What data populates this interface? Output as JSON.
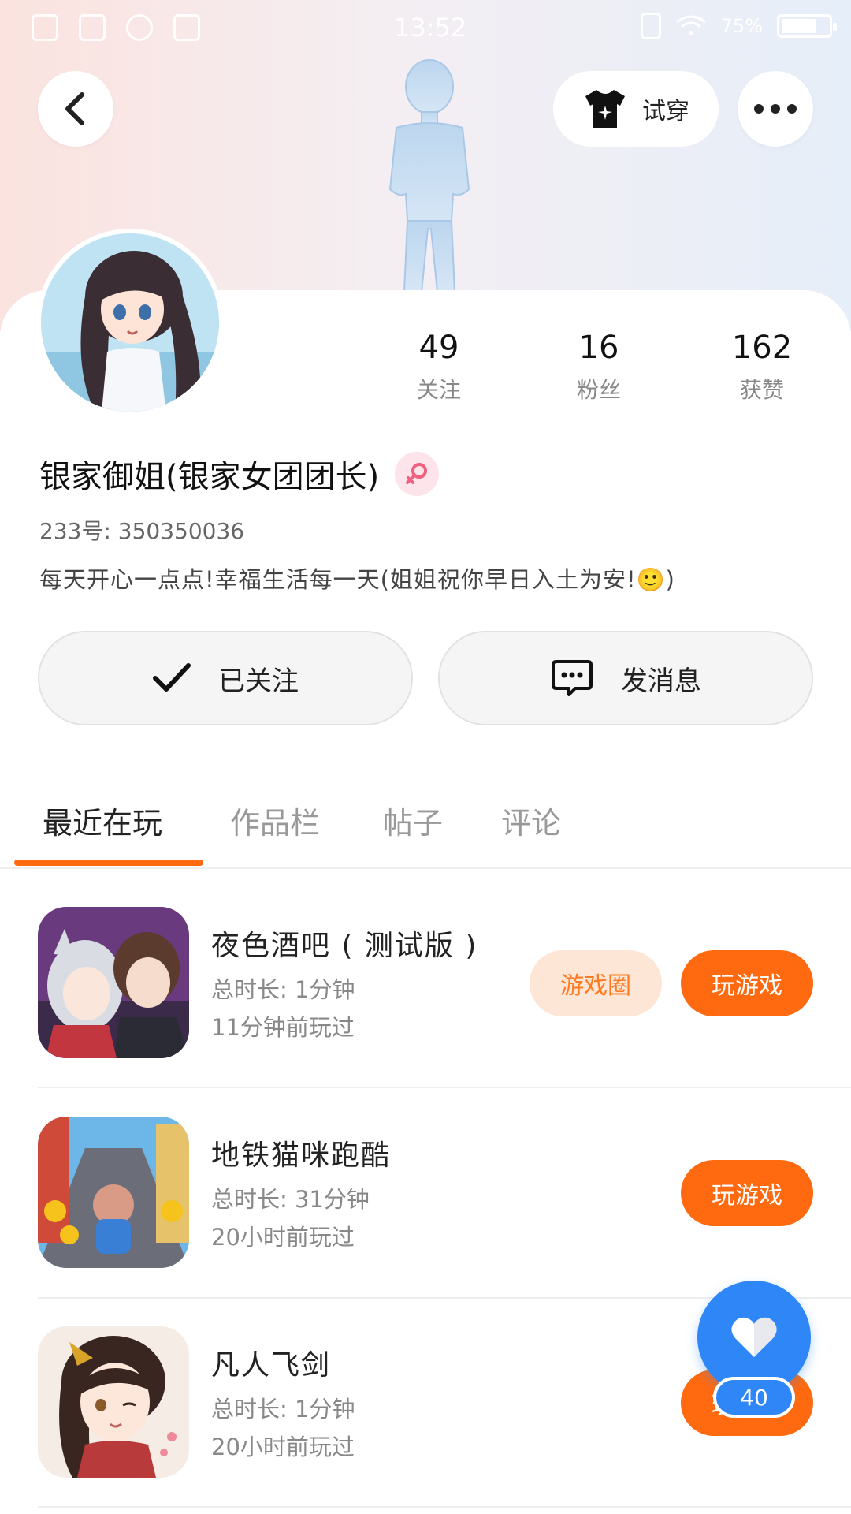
{
  "status_bar": {
    "time": "13:52",
    "battery": "75%",
    "battery_level": 0.75
  },
  "header": {
    "try_on_label": "试穿"
  },
  "profile": {
    "stats": [
      {
        "value": "49",
        "label": "关注"
      },
      {
        "value": "16",
        "label": "粉丝"
      },
      {
        "value": "162",
        "label": "获赞"
      }
    ],
    "username": "银家御姐(银家女团团长)",
    "uid": "233号: 350350036",
    "bio": "每天开心一点点!幸福生活每一天(姐姐祝你早日入土为安!🙂)"
  },
  "actions": {
    "follow_label": "已关注",
    "message_label": "发消息"
  },
  "tabs": [
    {
      "label": "最近在玩",
      "active": true
    },
    {
      "label": "作品栏",
      "active": false
    },
    {
      "label": "帖子",
      "active": false
    },
    {
      "label": "评论",
      "active": false
    }
  ],
  "games": [
    {
      "title": "夜色酒吧 ( 测试版 )",
      "total_time": "总时长: 1分钟",
      "last_played": "11分钟前玩过",
      "circle_label": "游戏圈",
      "play_label": "玩游戏"
    },
    {
      "title": "地铁猫咪跑酷",
      "total_time": "总时长: 31分钟",
      "last_played": "20小时前玩过",
      "play_label": "玩游戏"
    },
    {
      "title": "凡人飞剑",
      "total_time": "总时长: 1分钟",
      "last_played": "20小时前玩过",
      "play_label": "玩游戏"
    }
  ],
  "fab": {
    "count": "40"
  },
  "colors": {
    "accent": "#ff6a10",
    "accent_light": "#fde6d6",
    "fab_blue": "#2f86f6",
    "gender_pink": "#f0607f"
  }
}
